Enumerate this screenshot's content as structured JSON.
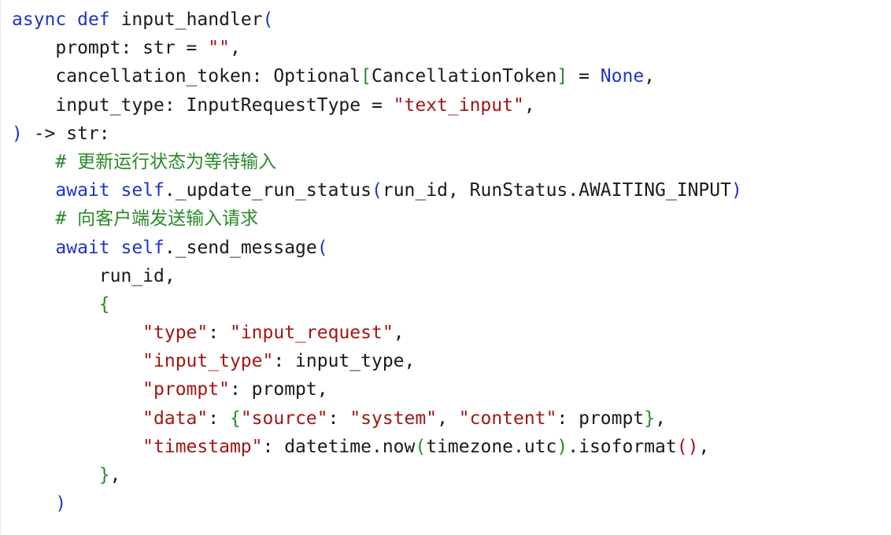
{
  "editor": {
    "lines": [
      [
        {
          "t": "async",
          "c": "kw"
        },
        {
          "t": " ",
          "c": "ident"
        },
        {
          "t": "def",
          "c": "kw"
        },
        {
          "t": " input_handler",
          "c": "ident"
        },
        {
          "t": "(",
          "c": "bkt"
        }
      ],
      [
        {
          "t": "    prompt: str = ",
          "c": "ident"
        },
        {
          "t": "\"\"",
          "c": "str"
        },
        {
          "t": ",",
          "c": "ident"
        }
      ],
      [
        {
          "t": "    cancellation_token: Optional",
          "c": "ident"
        },
        {
          "t": "[",
          "c": "bkt2"
        },
        {
          "t": "CancellationToken",
          "c": "ident"
        },
        {
          "t": "]",
          "c": "bkt2"
        },
        {
          "t": " = ",
          "c": "ident"
        },
        {
          "t": "None",
          "c": "kw"
        },
        {
          "t": ",",
          "c": "ident"
        }
      ],
      [
        {
          "t": "    input_type: InputRequestType = ",
          "c": "ident"
        },
        {
          "t": "\"text_input\"",
          "c": "str"
        },
        {
          "t": ",",
          "c": "ident"
        }
      ],
      [
        {
          "t": ")",
          "c": "bkt"
        },
        {
          "t": " -> str:",
          "c": "ident"
        }
      ],
      [
        {
          "t": "    ",
          "c": "ident"
        },
        {
          "t": "# 更新运行状态为等待输入",
          "c": "cmt"
        }
      ],
      [
        {
          "t": "    ",
          "c": "ident"
        },
        {
          "t": "await",
          "c": "kw"
        },
        {
          "t": " ",
          "c": "ident"
        },
        {
          "t": "self",
          "c": "kw"
        },
        {
          "t": "._update_run_status",
          "c": "ident"
        },
        {
          "t": "(",
          "c": "bkt"
        },
        {
          "t": "run_id, RunStatus.AWAITING_INPUT",
          "c": "ident"
        },
        {
          "t": ")",
          "c": "bkt"
        }
      ],
      [
        {
          "t": "    ",
          "c": "ident"
        },
        {
          "t": "# 向客户端发送输入请求",
          "c": "cmt"
        }
      ],
      [
        {
          "t": "    ",
          "c": "ident"
        },
        {
          "t": "await",
          "c": "kw"
        },
        {
          "t": " ",
          "c": "ident"
        },
        {
          "t": "self",
          "c": "kw"
        },
        {
          "t": "._send_message",
          "c": "ident"
        },
        {
          "t": "(",
          "c": "bkt"
        }
      ],
      [
        {
          "t": "        run_id,",
          "c": "ident"
        }
      ],
      [
        {
          "t": "        ",
          "c": "ident"
        },
        {
          "t": "{",
          "c": "bkt2"
        }
      ],
      [
        {
          "t": "            ",
          "c": "ident"
        },
        {
          "t": "\"type\"",
          "c": "str"
        },
        {
          "t": ": ",
          "c": "ident"
        },
        {
          "t": "\"input_request\"",
          "c": "str"
        },
        {
          "t": ",",
          "c": "ident"
        }
      ],
      [
        {
          "t": "            ",
          "c": "ident"
        },
        {
          "t": "\"input_type\"",
          "c": "str"
        },
        {
          "t": ": input_type,",
          "c": "ident"
        }
      ],
      [
        {
          "t": "            ",
          "c": "ident"
        },
        {
          "t": "\"prompt\"",
          "c": "str"
        },
        {
          "t": ": prompt,",
          "c": "ident"
        }
      ],
      [
        {
          "t": "            ",
          "c": "ident"
        },
        {
          "t": "\"data\"",
          "c": "str"
        },
        {
          "t": ": ",
          "c": "ident"
        },
        {
          "t": "{",
          "c": "bkt2"
        },
        {
          "t": "\"source\"",
          "c": "str"
        },
        {
          "t": ": ",
          "c": "ident"
        },
        {
          "t": "\"system\"",
          "c": "str"
        },
        {
          "t": ", ",
          "c": "ident"
        },
        {
          "t": "\"content\"",
          "c": "str"
        },
        {
          "t": ": prompt",
          "c": "ident"
        },
        {
          "t": "}",
          "c": "bkt2"
        },
        {
          "t": ",",
          "c": "ident"
        }
      ],
      [
        {
          "t": "            ",
          "c": "ident"
        },
        {
          "t": "\"timestamp\"",
          "c": "str"
        },
        {
          "t": ": datetime.now",
          "c": "ident"
        },
        {
          "t": "(",
          "c": "bkt2"
        },
        {
          "t": "timezone.utc",
          "c": "ident"
        },
        {
          "t": ")",
          "c": "bkt2"
        },
        {
          "t": ".isoformat",
          "c": "ident"
        },
        {
          "t": "()",
          "c": "str"
        },
        {
          "t": ",",
          "c": "ident"
        }
      ],
      [
        {
          "t": "        ",
          "c": "ident"
        },
        {
          "t": "}",
          "c": "bkt2"
        },
        {
          "t": ",",
          "c": "ident"
        }
      ],
      [
        {
          "t": "    ",
          "c": "ident"
        },
        {
          "t": ")",
          "c": "bkt"
        }
      ]
    ]
  }
}
